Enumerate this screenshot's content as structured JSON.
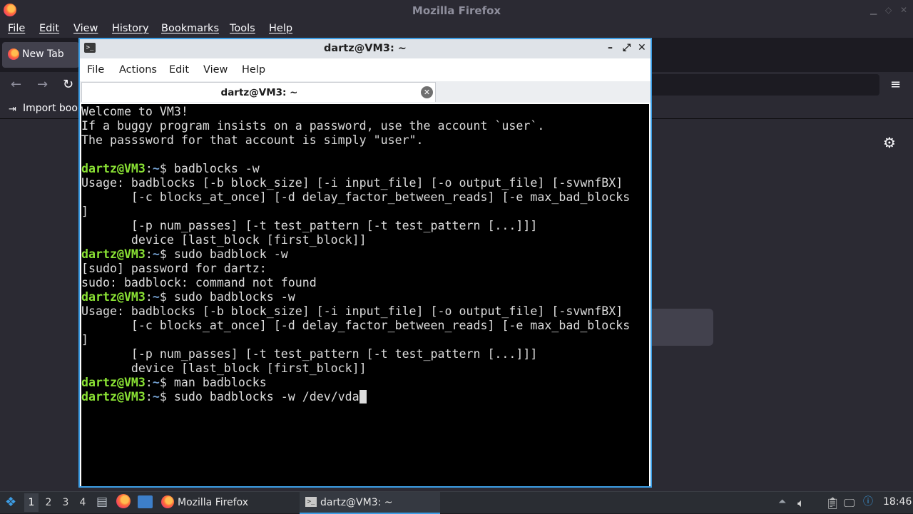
{
  "firefox": {
    "window_title": "Mozilla Firefox",
    "menu": [
      "File",
      "Edit",
      "View",
      "History",
      "Bookmarks",
      "Tools",
      "Help"
    ],
    "tab_label": "New Tab",
    "bookmarks_item": "Import book"
  },
  "terminal": {
    "window_title": "dartz@VM3: ~",
    "menu": [
      "File",
      "Actions",
      "Edit",
      "View",
      "Help"
    ],
    "tab_label": "dartz@VM3: ~",
    "lines": [
      {
        "t": "Welcome to VM3!"
      },
      {
        "t": "If a buggy program insists on a password, use the account `user`."
      },
      {
        "t": "The passsword for that account is simply \"user\"."
      },
      {
        "t": ""
      },
      {
        "u": "dartz@VM3",
        "p": "~",
        "c": "$ badblocks -w"
      },
      {
        "t": "Usage: badblocks [-b block_size] [-i input_file] [-o output_file] [-svwnfBX]"
      },
      {
        "t": "       [-c blocks_at_once] [-d delay_factor_between_reads] [-e max_bad_blocks"
      },
      {
        "t": "]"
      },
      {
        "t": "       [-p num_passes] [-t test_pattern [-t test_pattern [...]]]"
      },
      {
        "t": "       device [last_block [first_block]]"
      },
      {
        "u": "dartz@VM3",
        "p": "~",
        "c": "$ sudo badblock -w"
      },
      {
        "t": "[sudo] password for dartz:"
      },
      {
        "t": "sudo: badblock: command not found"
      },
      {
        "u": "dartz@VM3",
        "p": "~",
        "c": "$ sudo badblocks -w"
      },
      {
        "t": "Usage: badblocks [-b block_size] [-i input_file] [-o output_file] [-svwnfBX]"
      },
      {
        "t": "       [-c blocks_at_once] [-d delay_factor_between_reads] [-e max_bad_blocks"
      },
      {
        "t": "]"
      },
      {
        "t": "       [-p num_passes] [-t test_pattern [-t test_pattern [...]]]"
      },
      {
        "t": "       device [last_block [first_block]]"
      },
      {
        "u": "dartz@VM3",
        "p": "~",
        "c": "$ man badblocks"
      },
      {
        "u": "dartz@VM3",
        "p": "~",
        "c": "$ sudo badblocks -w /dev/vda",
        "cursor": true
      }
    ]
  },
  "taskbar": {
    "workspaces": [
      "1",
      "2",
      "3",
      "4"
    ],
    "active_workspace": "1",
    "firefox_task": "Mozilla Firefox",
    "terminal_task": "dartz@VM3: ~",
    "clock": "18:46"
  },
  "colors": {
    "accent": "#3d9ee5",
    "prompt_user": "#8ae234",
    "prompt_path": "#729fcf",
    "terminal_bg": "#000000"
  }
}
